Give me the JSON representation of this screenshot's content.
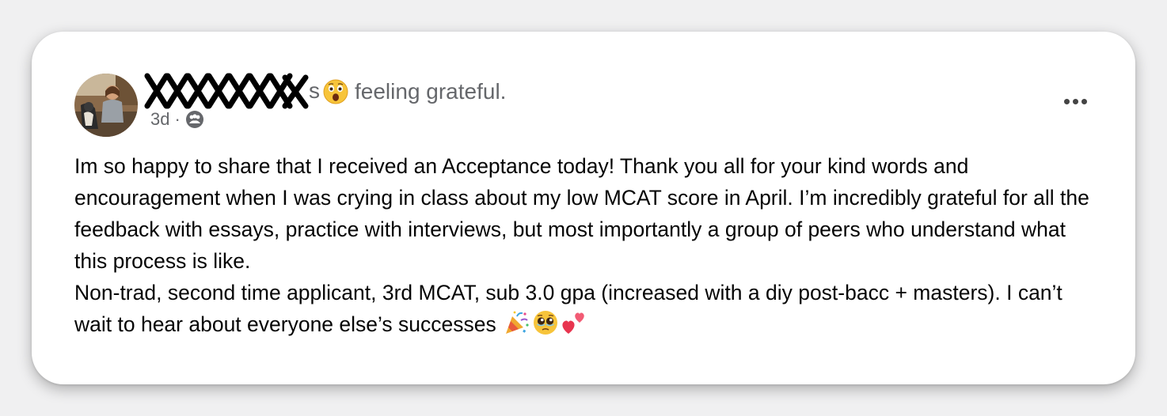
{
  "post": {
    "author_tail": "s",
    "feeling_text": "feeling grateful.",
    "feeling_icon": "astonished-face-icon",
    "time": "3d",
    "separator": "·",
    "audience_icon": "friends-audience-icon",
    "body_paragraph_1": "Im so happy to share that I received an Acceptance today! Thank you all for your kind words and encouragement when I was crying in class about my low MCAT score in April. I’m incredibly grateful for all the feedback with essays, practice with interviews, but most importantly a group of peers who understand what this process is like.",
    "body_paragraph_2": "Non-trad, second time applicant, 3rd MCAT, sub 3.0 gpa (increased with a diy post-bacc + masters). I can’t wait to hear about everyone else’s successes",
    "trailing_emojis": [
      "party-popper-icon",
      "pleading-face-icon",
      "two-hearts-icon"
    ]
  },
  "colors": {
    "card_bg": "#ffffff",
    "page_bg": "#f0f0f1",
    "secondary_text": "#65676b",
    "primary_text": "#050505"
  }
}
